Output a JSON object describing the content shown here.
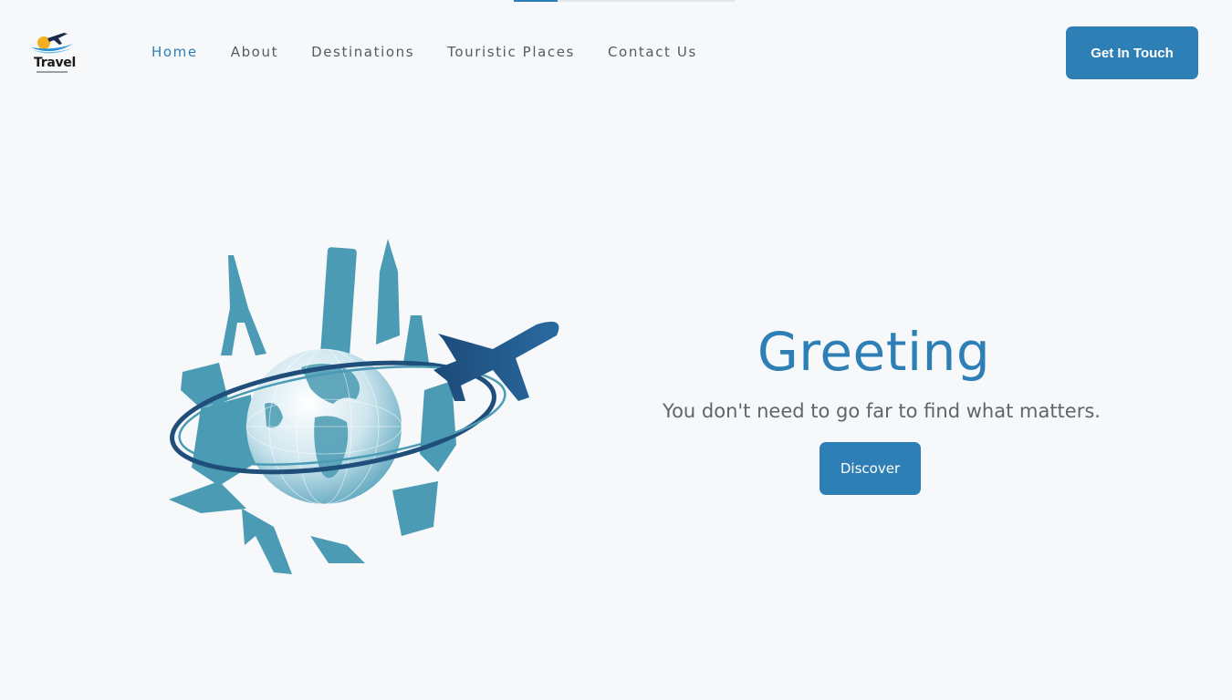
{
  "scroll_progress": 0.2,
  "brand": {
    "logo_text": "Travel",
    "logo_icon": "plane-sun-logo-icon"
  },
  "nav": {
    "items": [
      {
        "label": "Home",
        "active": true
      },
      {
        "label": "About",
        "active": false
      },
      {
        "label": "Destinations",
        "active": false
      },
      {
        "label": "Touristic Places",
        "active": false
      },
      {
        "label": "Contact Us",
        "active": false
      }
    ]
  },
  "header": {
    "cta_label": "Get In Touch"
  },
  "hero": {
    "title": "Greeting",
    "subtitle": "You don't need to go far to find what matters.",
    "button_label": "Discover",
    "illustration": "globe-landmarks-airplane-illustration"
  },
  "colors": {
    "accent": "#2f7fb7",
    "background": "#f6f8fa",
    "illustration_teal": "#4a9bb3",
    "airplane_navy": "#1f4e7a"
  }
}
